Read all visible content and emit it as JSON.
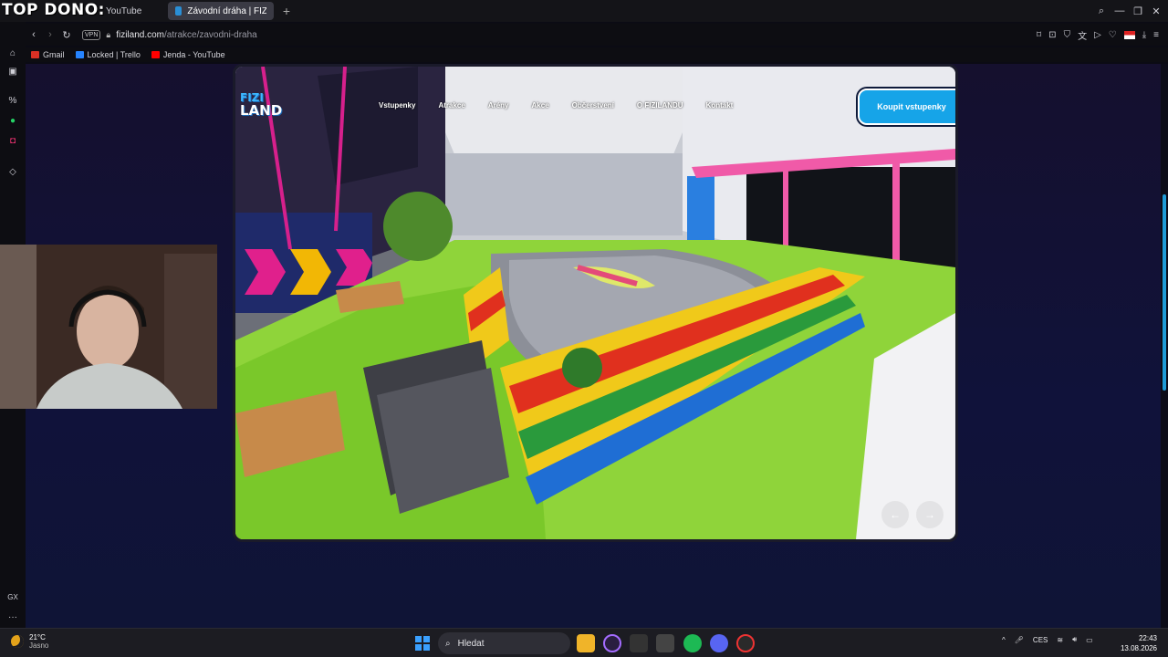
{
  "overlay_text": "TOP DONO:",
  "browser": {
    "tabs": [
      {
        "label": "YouTube",
        "active": false
      },
      {
        "label": "Závodní dráha | FIZILAND",
        "active": true
      }
    ],
    "new_tab_label": "+",
    "address": {
      "domain": "fiziland.com",
      "path": "/atrakce/zavodni-draha",
      "vpn_badge": "VPN"
    },
    "bookmarks": [
      {
        "label": "Gmail",
        "color": "#d93025"
      },
      {
        "label": "Locked | Trello",
        "color": "#2684ff"
      },
      {
        "label": "Jenda - YouTube",
        "color": "#ff0000"
      }
    ],
    "sidebar_icons": [
      "bag-icon",
      "messenger-icon",
      "percent-icon",
      "whatsapp-icon",
      "instagram-icon",
      "extensions-icon",
      "opera-gx-icon",
      "more-icon"
    ],
    "sidebar_text": {
      "gx": "GX",
      "more": "···"
    }
  },
  "site": {
    "logo": {
      "line1": "FIZI",
      "line2": "LAND"
    },
    "nav": [
      "Vstupenky",
      "Atrakce",
      "Arény",
      "Akce",
      "Občerstvení",
      "O FIZILANDU",
      "Kontakt"
    ],
    "buy_button": "Koupit vstupenky",
    "accent_color": "#16a4e8",
    "prev_arrow": "←",
    "next_arrow": "→"
  },
  "taskbar": {
    "weather": {
      "temp": "21°C",
      "condition": "Jasno"
    },
    "search_placeholder": "Hledat",
    "tray": {
      "language": "CES"
    },
    "clock": {
      "time": "22:43",
      "date": "13.08.2026"
    }
  }
}
